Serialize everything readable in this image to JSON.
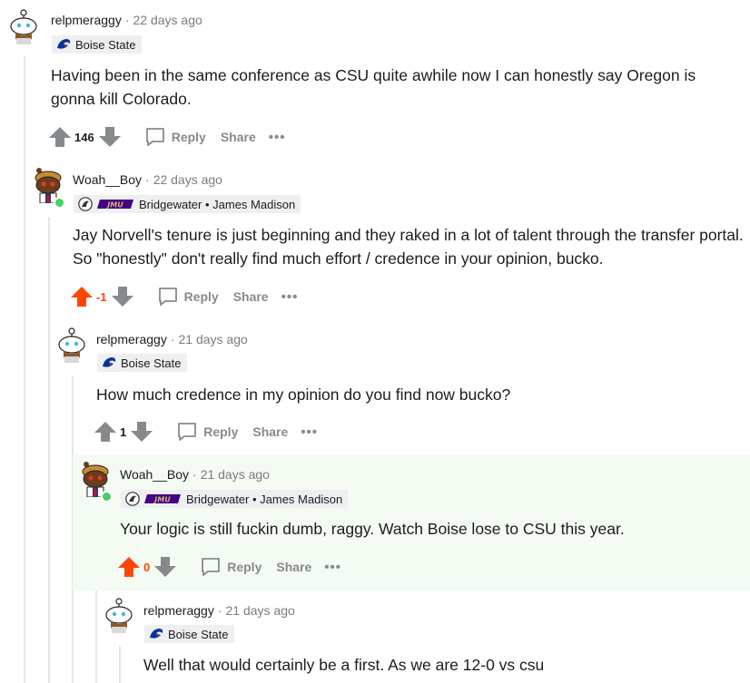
{
  "comments": [
    {
      "username": "relpmeraggy",
      "time": "22 days ago",
      "flair": "Boise State",
      "body": "Having been in the same conference as CSU quite awhile now I can honestly say Oregon is gonna kill Colorado.",
      "score": "146",
      "reply": "Reply",
      "share": "Share",
      "more": "•••"
    },
    {
      "username": "Woah__Boy",
      "time": "22 days ago",
      "flair": "Bridgewater • James Madison",
      "flair_logo_text": "JMU",
      "body": "Jay Norvell's tenure is just beginning and they raked in a lot of talent through the transfer portal. So \"honestly\" don't really find much effort / credence in your opinion, bucko.",
      "score": "-1",
      "reply": "Reply",
      "share": "Share",
      "more": "•••"
    },
    {
      "username": "relpmeraggy",
      "time": "21 days ago",
      "flair": "Boise State",
      "body": "How much credence in my opinion do you find now bucko?",
      "score": "1",
      "reply": "Reply",
      "share": "Share",
      "more": "•••"
    },
    {
      "username": "Woah__Boy",
      "time": "21 days ago",
      "flair": "Bridgewater • James Madison",
      "flair_logo_text": "JMU",
      "body": "Your logic is still fuckin dumb, raggy. Watch Boise lose to CSU this year.",
      "score": "0",
      "reply": "Reply",
      "share": "Share",
      "more": "•••"
    },
    {
      "username": "relpmeraggy",
      "time": "21 days ago",
      "flair": "Boise State",
      "body": "Well that would certainly be a first. As we are 12-0 vs csu"
    }
  ],
  "separator": "·",
  "colors": {
    "upvote_active": "#ff4500",
    "vote_inactive": "#878a8c",
    "thread_line": "#e5e7e8",
    "highlight_bg": "#f3fbf2",
    "online": "#46d160"
  }
}
